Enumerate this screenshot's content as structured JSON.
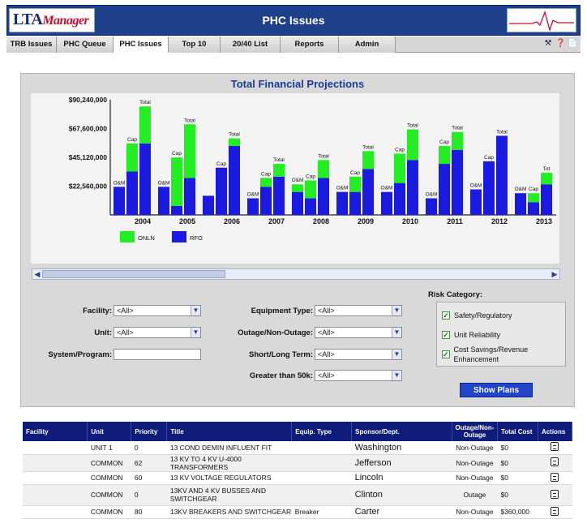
{
  "header": {
    "logo_main": "LTA",
    "logo_sub": "Manager",
    "title": "PHC Issues"
  },
  "tabs": [
    {
      "label": "TRB Issues",
      "active": false
    },
    {
      "label": "PHC Queue",
      "active": false
    },
    {
      "label": "PHC Issues",
      "active": true
    },
    {
      "label": "Top 10",
      "active": false
    },
    {
      "label": "20/40 List",
      "active": false
    },
    {
      "label": "Reports",
      "active": false
    },
    {
      "label": "Admin",
      "active": false
    }
  ],
  "tab_icons": [
    "tools-icon",
    "help-icon",
    "document-icon"
  ],
  "chart_data": {
    "type": "bar",
    "title": "Total Financial Projections",
    "ylim": [
      0,
      90240000
    ],
    "yticks": [
      "$90,240,000",
      "$67,600,000",
      "$45,120,000",
      "$22,560,000"
    ],
    "ytick_values": [
      90240000,
      67600000,
      45120000,
      22560000
    ],
    "years": [
      "2004",
      "2005",
      "2006",
      "2007",
      "2008",
      "2009",
      "2010",
      "2011",
      "2012",
      "2013"
    ],
    "legend": [
      {
        "name": "ONLN",
        "color": "#22ee22"
      },
      {
        "name": "RFO",
        "color": "#1a1ae0"
      }
    ],
    "groups": [
      {
        "year": "2004",
        "bars": [
          {
            "label": "O&M",
            "rfo": 22000000,
            "onln": 0
          },
          {
            "label": "Cap",
            "rfo": 34000000,
            "onln": 22000000
          },
          {
            "label": "Total",
            "rfo": 56000000,
            "onln": 29000000
          }
        ]
      },
      {
        "year": "2005",
        "bars": [
          {
            "label": "O&M",
            "rfo": 22000000,
            "onln": 0
          },
          {
            "label": "Cap",
            "rfo": 7000000,
            "onln": 38000000
          },
          {
            "label": "Total",
            "rfo": 29000000,
            "onln": 42000000
          }
        ]
      },
      {
        "year": "2006",
        "bars": [
          {
            "label": "",
            "rfo": 15000000,
            "onln": 0
          },
          {
            "label": "Cap",
            "rfo": 37000000,
            "onln": 0
          },
          {
            "label": "Total",
            "rfo": 54000000,
            "onln": 6000000
          }
        ]
      },
      {
        "year": "2007",
        "bars": [
          {
            "label": "O&M",
            "rfo": 13000000,
            "onln": 0
          },
          {
            "label": "Cap",
            "rfo": 22000000,
            "onln": 7000000
          },
          {
            "label": "Total",
            "rfo": 30000000,
            "onln": 10000000
          }
        ]
      },
      {
        "year": "2008",
        "bars": [
          {
            "label": "O&M",
            "rfo": 18000000,
            "onln": 6000000
          },
          {
            "label": "Cap",
            "rfo": 13000000,
            "onln": 14000000
          },
          {
            "label": "Total",
            "rfo": 29000000,
            "onln": 14000000
          }
        ]
      },
      {
        "year": "2009",
        "bars": [
          {
            "label": "O&M",
            "rfo": 18000000,
            "onln": 0
          },
          {
            "label": "Cap",
            "rfo": 18000000,
            "onln": 12000000
          },
          {
            "label": "Total",
            "rfo": 36000000,
            "onln": 14000000
          }
        ]
      },
      {
        "year": "2010",
        "bars": [
          {
            "label": "O&M",
            "rfo": 18000000,
            "onln": 0
          },
          {
            "label": "Cap",
            "rfo": 25000000,
            "onln": 23000000
          },
          {
            "label": "Total",
            "rfo": 43000000,
            "onln": 24000000
          }
        ]
      },
      {
        "year": "2011",
        "bars": [
          {
            "label": "O&M",
            "rfo": 13000000,
            "onln": 0
          },
          {
            "label": "Cap",
            "rfo": 40000000,
            "onln": 14000000
          },
          {
            "label": "Total",
            "rfo": 51000000,
            "onln": 14000000
          }
        ]
      },
      {
        "year": "2012",
        "bars": [
          {
            "label": "O&M",
            "rfo": 20000000,
            "onln": 0
          },
          {
            "label": "Cap",
            "rfo": 42000000,
            "onln": 0
          },
          {
            "label": "Total",
            "rfo": 62000000,
            "onln": 0
          }
        ]
      },
      {
        "year": "2013",
        "bars": [
          {
            "label": "O&M",
            "rfo": 17000000,
            "onln": 0
          },
          {
            "label": "Cap",
            "rfo": 10000000,
            "onln": 7000000
          },
          {
            "label": "Tot",
            "rfo": 24000000,
            "onln": 9000000
          }
        ]
      }
    ]
  },
  "filters": {
    "facility_label": "Facility:",
    "facility_value": "<All>",
    "unit_label": "Unit:",
    "unit_value": "<All>",
    "system_label": "System/Program:",
    "system_value": "",
    "equipment_label": "Equipment Type:",
    "equipment_value": "<All>",
    "outage_label": "Outage/Non-Outage:",
    "outage_value": "<All>",
    "term_label": "Short/Long Term:",
    "term_value": "<All>",
    "gt50_label": "Greater than 50k:",
    "gt50_value": "<All>"
  },
  "risk": {
    "title": "Risk Category:",
    "items": [
      {
        "label": "Safety/Regulatory",
        "checked": true
      },
      {
        "label": "Unit Reliability",
        "checked": true
      },
      {
        "label": "Cost Savings/Revenue Enhancement",
        "checked": true
      }
    ]
  },
  "show_plans_label": "Show Plans",
  "table": {
    "headers": [
      "Facility",
      "Unit",
      "Priority",
      "Title",
      "Equip. Type",
      "Sponsor/Dept.",
      "Outage/Non-Outage",
      "Total Cost",
      "Actions"
    ],
    "rows": [
      {
        "facility": "",
        "unit": "UNIT 1",
        "priority": "0",
        "title": "13 COND DEMIN INFLUENT FIT",
        "equip": "",
        "sponsor": "Washington",
        "outage": "Non-Outage",
        "cost": "$0"
      },
      {
        "facility": "",
        "unit": "COMMON",
        "priority": "62",
        "title": "13 KV TO 4 KV U-4000 TRANSFORMERS",
        "equip": "",
        "sponsor": "Jefferson",
        "outage": "Non-Outage",
        "cost": "$0"
      },
      {
        "facility": "",
        "unit": "COMMON",
        "priority": "60",
        "title": "13 KV VOLTAGE REGULATORS",
        "equip": "",
        "sponsor": "Lincoln",
        "outage": "Non-Outage",
        "cost": "$0"
      },
      {
        "facility": "",
        "unit": "COMMON",
        "priority": "0",
        "title": "13KV AND 4 KV BUSSES AND SWITCHGEAR",
        "equip": "",
        "sponsor": "Clinton",
        "outage": "Outage",
        "cost": "$0"
      },
      {
        "facility": "",
        "unit": "COMMON",
        "priority": "80",
        "title": "13KV BREAKERS AND SWITCHGEAR",
        "equip": "Breaker",
        "sponsor": "Carter",
        "outage": "Non-Outage",
        "cost": "$360,000"
      }
    ]
  }
}
